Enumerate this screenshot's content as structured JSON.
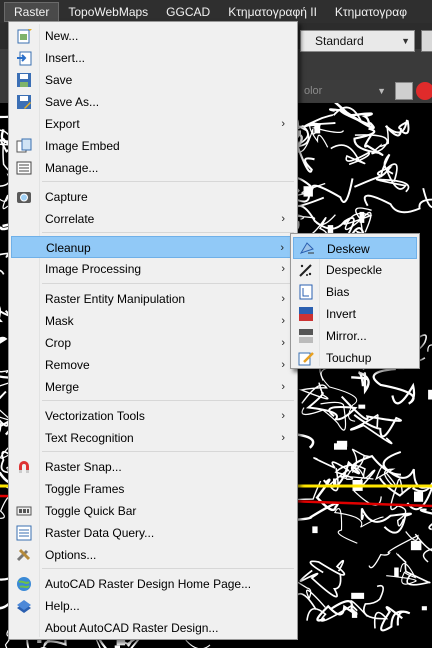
{
  "menubar": {
    "items": [
      "Raster",
      "TopoWebMaps",
      "GGCAD",
      "Κτηματογραφή II",
      "Κτηματογραφ"
    ]
  },
  "toolbar": {
    "style_value": "Standard",
    "color_placeholder": "olor"
  },
  "raster_menu": {
    "items": [
      {
        "label": "New...",
        "icon": "new-raster-icon"
      },
      {
        "label": "Insert...",
        "icon": "insert-icon"
      },
      {
        "label": "Save",
        "icon": "save-icon"
      },
      {
        "label": "Save As...",
        "icon": "save-as-icon"
      },
      {
        "label": "Export",
        "icon": "",
        "submenu": true
      },
      {
        "label": "Image Embed",
        "icon": "image-embed-icon"
      },
      {
        "label": "Manage...",
        "icon": "manage-icon"
      },
      {
        "label": "Capture",
        "icon": "capture-icon"
      },
      {
        "label": "Correlate",
        "icon": "",
        "submenu": true
      },
      {
        "label": "Cleanup",
        "icon": "",
        "submenu": true,
        "highlighted": true
      },
      {
        "label": "Image Processing",
        "icon": "",
        "submenu": true
      },
      {
        "label": "Raster Entity Manipulation",
        "icon": "",
        "submenu": true
      },
      {
        "label": "Mask",
        "icon": "",
        "submenu": true
      },
      {
        "label": "Crop",
        "icon": "",
        "submenu": true
      },
      {
        "label": "Remove",
        "icon": "",
        "submenu": true
      },
      {
        "label": "Merge",
        "icon": "",
        "submenu": true
      },
      {
        "label": "Vectorization Tools",
        "icon": "",
        "submenu": true
      },
      {
        "label": "Text Recognition",
        "icon": "",
        "submenu": true
      },
      {
        "label": "Raster Snap...",
        "icon": "magnet-icon"
      },
      {
        "label": "Toggle Frames",
        "icon": ""
      },
      {
        "label": "Toggle Quick Bar",
        "icon": "quick-bar-icon"
      },
      {
        "label": "Raster Data Query...",
        "icon": "data-query-icon"
      },
      {
        "label": "Options...",
        "icon": "options-icon"
      },
      {
        "label": "AutoCAD Raster Design Home Page...",
        "icon": "home-page-icon"
      },
      {
        "label": "Help...",
        "icon": "help-icon"
      },
      {
        "label": "About AutoCAD Raster Design...",
        "icon": ""
      }
    ]
  },
  "cleanup_submenu": {
    "items": [
      {
        "label": "Deskew",
        "icon": "deskew-icon",
        "highlighted": true
      },
      {
        "label": "Despeckle",
        "icon": "despeckle-icon"
      },
      {
        "label": "Bias",
        "icon": "bias-icon"
      },
      {
        "label": "Invert",
        "icon": "invert-icon"
      },
      {
        "label": "Mirror...",
        "icon": "mirror-icon"
      },
      {
        "label": "Touchup",
        "icon": "touchup-icon"
      }
    ]
  },
  "colors": {
    "menu_bg": "#f0f0f0",
    "highlight": "#91c9f7",
    "menubar_bg": "#2f2f2f"
  }
}
